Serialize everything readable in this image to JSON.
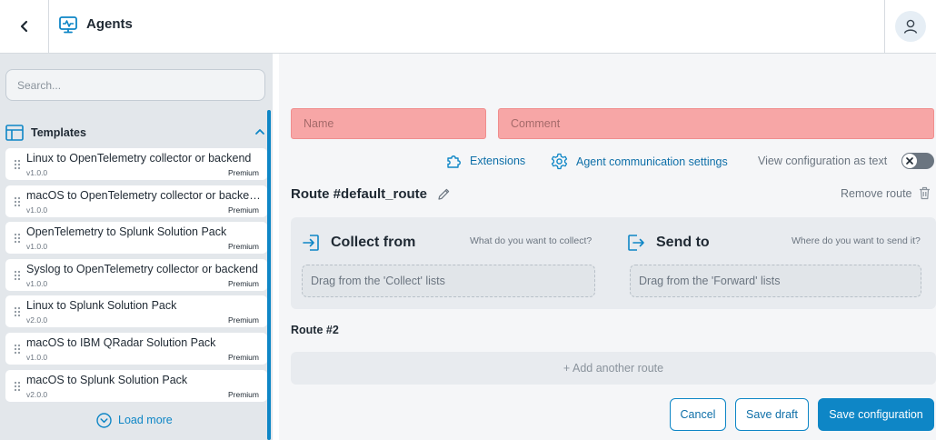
{
  "app": {
    "title": "Agents"
  },
  "search": {
    "placeholder": "Search..."
  },
  "templates": {
    "heading": "Templates",
    "items": [
      {
        "name": "Linux to OpenTelemetry collector or backend",
        "version": "v1.0.0",
        "badge": "Premium"
      },
      {
        "name": "macOS to OpenTelemetry collector or backend",
        "version": "v1.0.0",
        "badge": "Premium"
      },
      {
        "name": "OpenTelemetry to Splunk Solution Pack",
        "version": "v1.0.0",
        "badge": "Premium"
      },
      {
        "name": "Syslog to OpenTelemetry collector or backend",
        "version": "v1.0.0",
        "badge": "Premium"
      },
      {
        "name": "Linux to Splunk Solution Pack",
        "version": "v2.0.0",
        "badge": "Premium"
      },
      {
        "name": "macOS to IBM QRadar Solution Pack",
        "version": "v1.0.0",
        "badge": "Premium"
      },
      {
        "name": "macOS to Splunk Solution Pack",
        "version": "v2.0.0",
        "badge": "Premium"
      }
    ],
    "load_more": "Load more"
  },
  "form": {
    "name_placeholder": "Name",
    "comment_placeholder": "Comment"
  },
  "toolbar": {
    "extensions": "Extensions",
    "agent_settings": "Agent communication settings",
    "view_as_text": "View configuration as text",
    "view_as_text_enabled": false
  },
  "route": {
    "title": "Route #default_route",
    "remove": "Remove route",
    "collect": {
      "title": "Collect from",
      "hint": "What do you want to collect?",
      "drop": "Drag from the 'Collect' lists"
    },
    "send": {
      "title": "Send to",
      "hint": "Where do you want to send it?",
      "drop": "Drag from the 'Forward' lists"
    }
  },
  "route2": {
    "title": "Route #2"
  },
  "add_route": "+ Add another route",
  "actions": {
    "cancel": "Cancel",
    "save_draft": "Save draft",
    "save_config": "Save configuration"
  },
  "colors": {
    "accent": "#0e86c6",
    "error_field": "#f7a6a6",
    "sidebar_bg": "#e3e7eb",
    "main_bg": "#f5f6f8"
  }
}
